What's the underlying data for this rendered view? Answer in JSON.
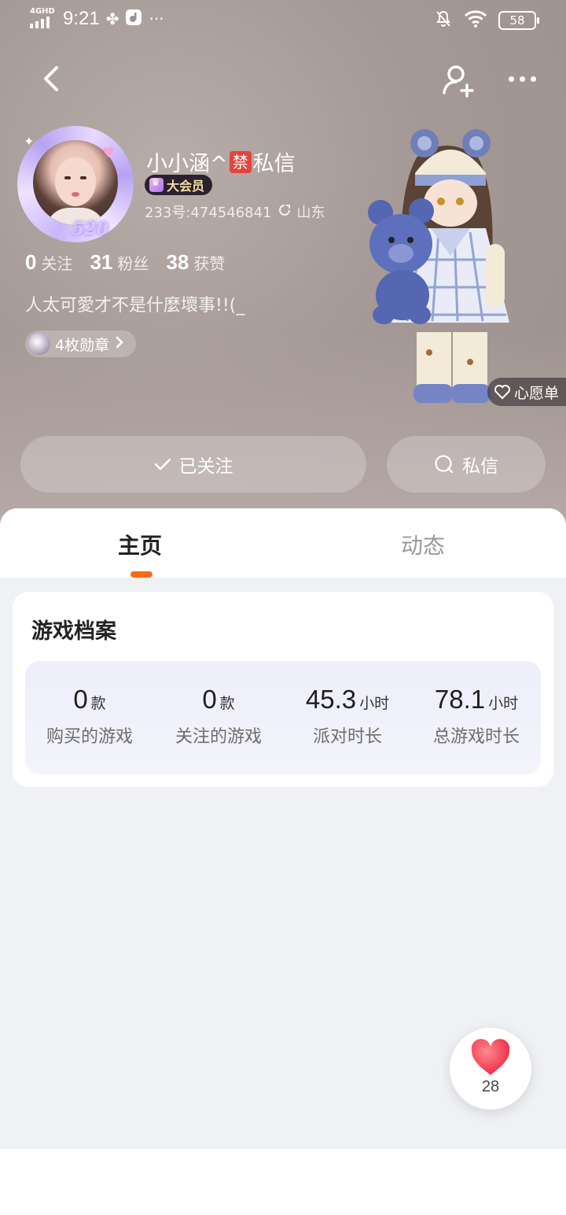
{
  "status_bar": {
    "network": "4GHD",
    "time": "9:21",
    "battery": "58"
  },
  "profile": {
    "nickname_prefix": "小小涵^",
    "ban_icon": "禁",
    "nickname_suffix": "私信",
    "vip_label": "大会员",
    "id_text": "233号:474546841",
    "location": "山东",
    "stats": {
      "following_count": "0",
      "following_label": "关注",
      "fans_count": "31",
      "fans_label": "粉丝",
      "likes_count": "38",
      "likes_label": "获赞"
    },
    "bio": "人太可愛才不是什麼壞事!!(_",
    "medals": "4枚勋章",
    "avatar_frame_text": "520"
  },
  "character": {
    "wishlist_label": "心愿单"
  },
  "actions": {
    "follow_label": "已关注",
    "message_label": "私信"
  },
  "tabs": [
    {
      "label": "主页"
    },
    {
      "label": "动态"
    }
  ],
  "game_profile": {
    "title": "游戏档案",
    "items": [
      {
        "value": "0",
        "unit": "款",
        "label": "购买的游戏"
      },
      {
        "value": "0",
        "unit": "款",
        "label": "关注的游戏"
      },
      {
        "value": "45.3",
        "unit": "小时",
        "label": "派对时长"
      },
      {
        "value": "78.1",
        "unit": "小时",
        "label": "总游戏时长"
      }
    ]
  },
  "like_button": {
    "count": "28"
  },
  "colors": {
    "accent": "#ff6a16",
    "ban": "#e1453e",
    "like": "#ff4d5e"
  },
  "icons": [
    "back-icon",
    "add-friend-icon",
    "more-icon",
    "copy-icon",
    "chevron-right-icon",
    "heart-outline-icon",
    "check-icon",
    "chat-icon",
    "heart-icon",
    "wifi-icon",
    "bell-off-icon"
  ]
}
